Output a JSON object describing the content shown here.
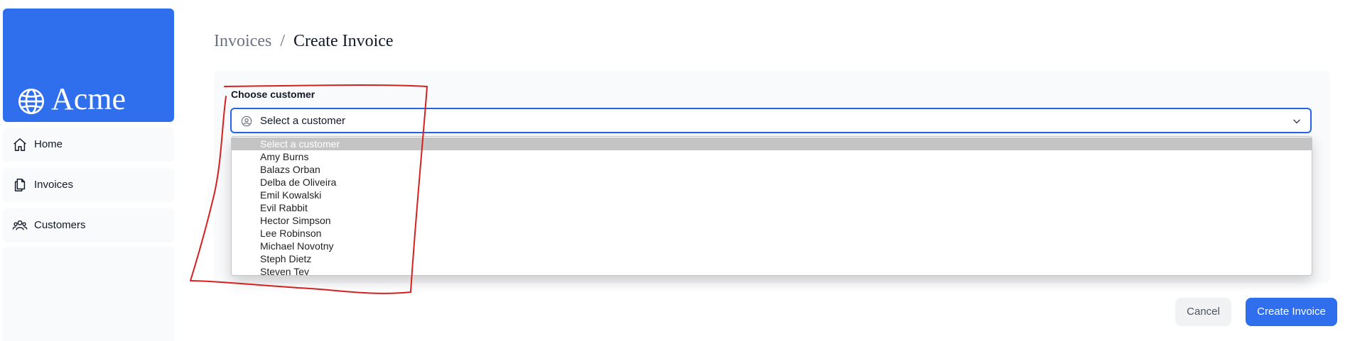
{
  "brand": {
    "name": "Acme",
    "icon": "globe-icon",
    "color": "#2f6fed"
  },
  "sidebar": {
    "items": [
      {
        "label": "Home",
        "icon": "home-icon"
      },
      {
        "label": "Invoices",
        "icon": "document-icon"
      },
      {
        "label": "Customers",
        "icon": "users-icon"
      }
    ]
  },
  "breadcrumb": {
    "parent": "Invoices",
    "separator": "/",
    "current": "Create Invoice"
  },
  "form": {
    "customer_label": "Choose customer",
    "customer_select": {
      "value": "Select a customer",
      "icon": "user-circle-icon",
      "options": [
        "Select a customer",
        "Amy Burns",
        "Balazs Orban",
        "Delba de Oliveira",
        "Emil Kowalski",
        "Evil Rabbit",
        "Hector Simpson",
        "Lee Robinson",
        "Michael Novotny",
        "Steph Dietz",
        "Steven Tey"
      ],
      "highlighted_index": 0
    }
  },
  "actions": {
    "cancel_label": "Cancel",
    "create_label": "Create Invoice"
  },
  "colors": {
    "accent": "#2f6fed",
    "focus_border": "#2563eb",
    "annotation": "#d62020"
  }
}
